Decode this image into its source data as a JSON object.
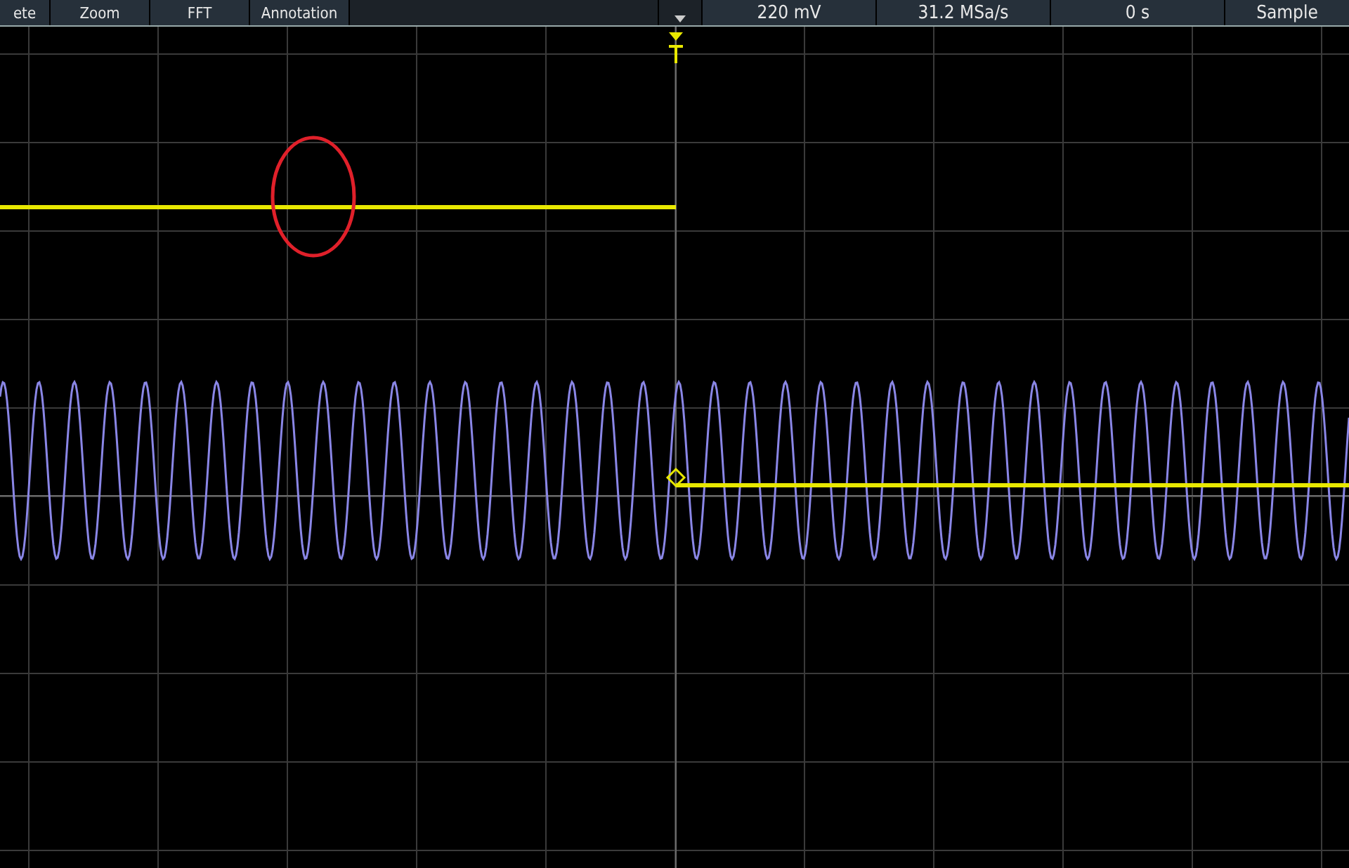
{
  "toolbar": {
    "buttons": [
      {
        "label": "ete"
      },
      {
        "label": "Zoom"
      },
      {
        "label": "FFT"
      },
      {
        "label": "Annotation"
      }
    ]
  },
  "readouts": [
    {
      "label": "220 mV"
    },
    {
      "label": "31.2 MSa/s"
    },
    {
      "label": "0 s"
    },
    {
      "label": "Sample"
    }
  ]
}
